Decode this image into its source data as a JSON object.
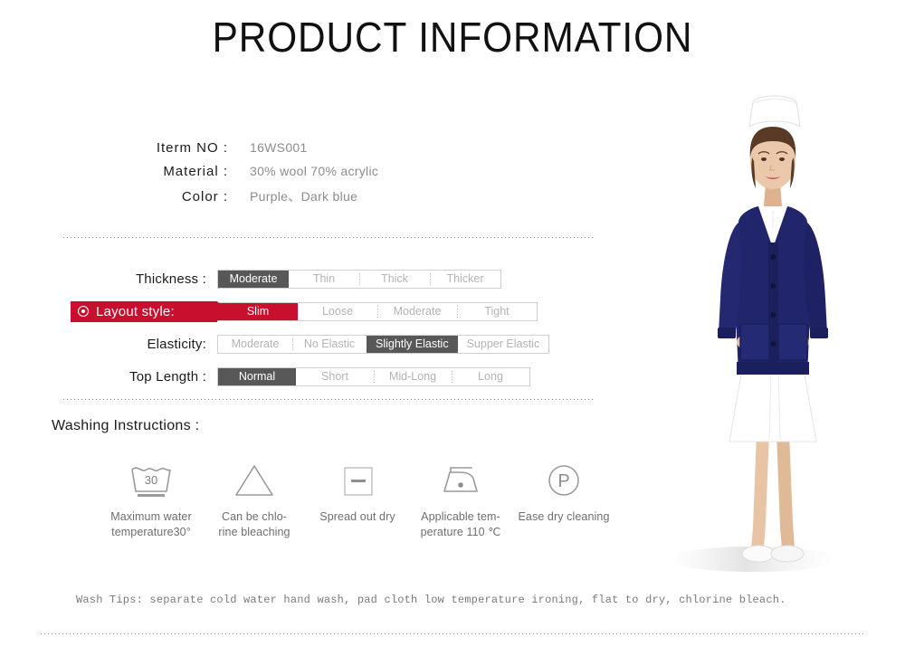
{
  "header": {
    "title": "PRODUCT INFORMATION"
  },
  "specs": [
    {
      "label": "Iterm NO :",
      "value": "16WS001"
    },
    {
      "label": "Material  :",
      "value": "30% wool 70% acrylic"
    },
    {
      "label": "Color :",
      "value": "Purple、Dark blue"
    }
  ],
  "attributes": [
    {
      "label": "Thickness :",
      "highlighted": false,
      "options": [
        "Moderate",
        "Thin",
        "Thick",
        "Thicker"
      ],
      "selected": "Moderate"
    },
    {
      "label": "Layout style:",
      "highlighted": true,
      "options": [
        "Slim",
        "Loose",
        "Moderate",
        "Tight"
      ],
      "selected": "Slim"
    },
    {
      "label": "Elasticity:",
      "highlighted": false,
      "options": [
        "Moderate",
        "No Elastic",
        "Slightly Elastic",
        "Supper  Elastic"
      ],
      "selected": "Slightly Elastic"
    },
    {
      "label": "Top Length :",
      "highlighted": false,
      "options": [
        "Normal",
        "Short",
        "Mid-Long",
        "Long"
      ],
      "selected": "Normal"
    }
  ],
  "washing": {
    "heading": "Washing Instructions :",
    "items": [
      {
        "icon": "wash-tub-30-icon",
        "temperature": "30",
        "caption": "Maximum water\ntemperature30°"
      },
      {
        "icon": "bleach-triangle-icon",
        "caption": "Can be chlo-\nrine bleaching"
      },
      {
        "icon": "flat-dry-square-icon",
        "caption": "Spread out dry"
      },
      {
        "icon": "iron-one-dot-icon",
        "caption": "Applicable tem-\nperature 110 ℃"
      },
      {
        "icon": "dry-clean-p-circle-icon",
        "letter": "P",
        "caption": "Ease dry cleaning"
      }
    ],
    "tips": "Wash Tips: separate cold water hand wash, pad cloth low temperature ironing, flat to dry, chlorine bleach."
  },
  "colors": {
    "accent_red": "#c8102e",
    "selected_gray": "#585858",
    "option_text": "#b3b3b3",
    "garment_navy": "#21256b"
  },
  "photo": {
    "alt": "model-wearing-navy-cardigan"
  }
}
